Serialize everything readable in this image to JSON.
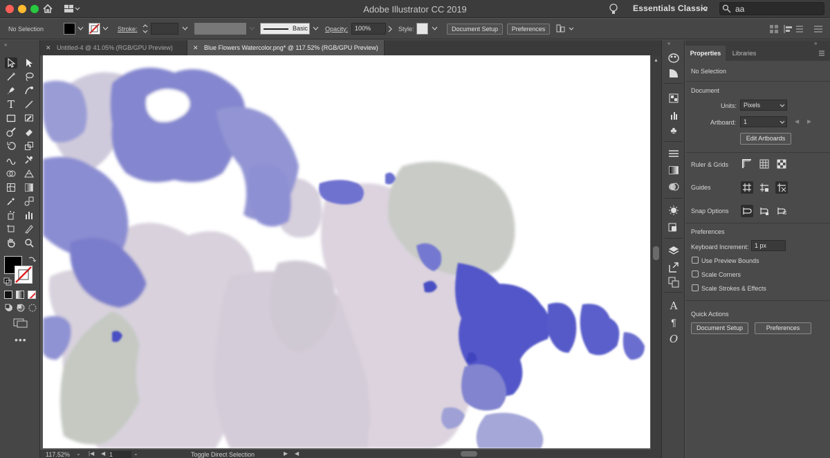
{
  "app": {
    "title": "Adobe Illustrator CC 2019",
    "workspace": "Essentials Classic"
  },
  "search": {
    "value": "aa"
  },
  "control": {
    "selection": "No Selection",
    "stroke_label": "Stroke:",
    "brush": "Basic",
    "opacity_label": "Opacity:",
    "opacity_value": "100%",
    "style_label": "Style:",
    "document_setup": "Document Setup",
    "preferences": "Preferences"
  },
  "tabs": [
    {
      "label": "Untitled-4 @ 41.05% (RGB/GPU Preview)",
      "active": false
    },
    {
      "label": "Blue Flowers Watercolor.png* @ 117.52% (RGB/GPU Preview)",
      "active": true
    }
  ],
  "status": {
    "zoom": "117.52%",
    "artboard": "1",
    "text": "Toggle Direct Selection"
  },
  "props": {
    "tab_properties": "Properties",
    "tab_libraries": "Libraries",
    "no_selection": "No Selection",
    "document_header": "Document",
    "units_label": "Units:",
    "units_value": "Pixels",
    "artboard_label": "Artboard:",
    "artboard_value": "1",
    "edit_artboards": "Edit Artboards",
    "ruler_grids": "Ruler & Grids",
    "guides": "Guides",
    "snap_options": "Snap Options",
    "preferences_header": "Preferences",
    "keyboard_increment_label": "Keyboard Increment:",
    "keyboard_increment_value": "1 px",
    "use_preview_bounds": "Use Preview Bounds",
    "scale_corners": "Scale Corners",
    "scale_strokes": "Scale Strokes & Effects",
    "quick_actions": "Quick Actions",
    "qa_document_setup": "Document Setup",
    "qa_preferences": "Preferences"
  },
  "colors": {
    "accent": "#5a5fd0",
    "canvas": "#ffffff",
    "ui_dark": "#464646"
  }
}
